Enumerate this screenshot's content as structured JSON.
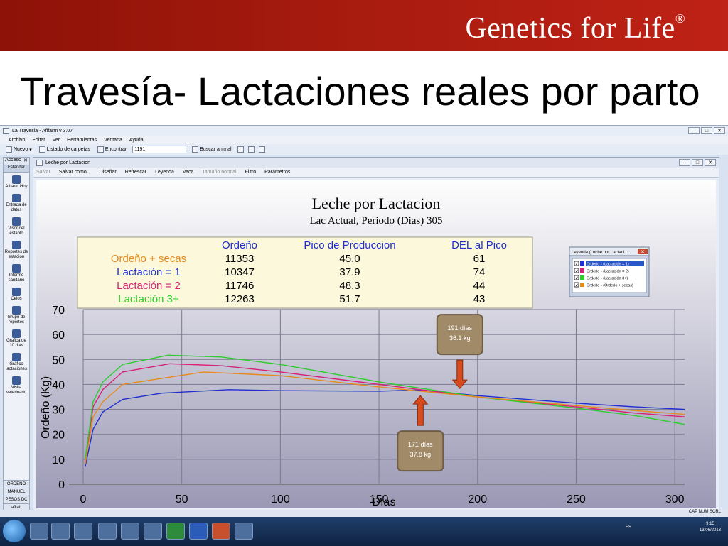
{
  "slide": {
    "brand": "Genetics for Life",
    "brand_mark": "®",
    "title": "Travesía- Lactaciones reales por parto"
  },
  "app": {
    "title": "La Travesia - Afifarm v 3.07",
    "menu": [
      "Archivo",
      "Editar",
      "Ver",
      "Herramientas",
      "Ventana",
      "Ayuda"
    ],
    "toolbar": {
      "nuevo": "Nuevo",
      "listado": "Listado de carpetas",
      "encontrar": "Encontrar",
      "search_value": "1191",
      "buscar": "Buscar animal"
    },
    "sidebar": {
      "header": "Acceso",
      "tab": "Estandar",
      "items": [
        "Afifarm Hoy",
        "Entrada de datos",
        "Visor del establo",
        "Reportes de estacion",
        "Informe sanitario",
        "Celos",
        "Grupo de reportes",
        "Grafica de 10 dias",
        "Gráfico lactaciones",
        "Visita veterinario"
      ],
      "bottom": [
        "ORDEÑO",
        "MANUEL",
        "PESOS DC",
        "afilab"
      ]
    },
    "child": {
      "title": "Leche por Lactacion",
      "toolbar": [
        "Salvar",
        "Salvar como...",
        "Diseñar",
        "Refrescar",
        "Leyenda",
        "Vaca",
        "Tamaño normal",
        "Filtro",
        "Parámetros"
      ]
    },
    "status": "CAP NUM SCRL",
    "tray": {
      "lang": "ES",
      "time": "9:15",
      "date": "13/06/2013"
    }
  },
  "chart_data": {
    "type": "line",
    "title": "Leche por Lactacion",
    "subtitle": "Lac Actual, Periodo (Dias) 305",
    "xlabel": "Días",
    "ylabel": "Ordeño (Kg)",
    "xlim": [
      0,
      305
    ],
    "ylim": [
      0,
      70
    ],
    "xticks": [
      0,
      50,
      100,
      150,
      200,
      250,
      300
    ],
    "yticks": [
      0,
      10,
      20,
      30,
      40,
      50,
      60,
      70
    ],
    "grid": true,
    "table": {
      "headers": [
        "Ordeño",
        "Pico de Produccion",
        "DEL al Pico"
      ],
      "rows": [
        {
          "label": "Ordeño + secas",
          "color": "#e68a1e",
          "ordeno": "11353",
          "pico": "45.0",
          "del": "61"
        },
        {
          "label": "Lactación = 1",
          "color": "#1f2fcf",
          "ordeno": "10347",
          "pico": "37.9",
          "del": "74"
        },
        {
          "label": "Lactación = 2",
          "color": "#d8207a",
          "ordeno": "11746",
          "pico": "48.3",
          "del": "44"
        },
        {
          "label": "Lactación 3+",
          "color": "#2ecc2e",
          "ordeno": "12263",
          "pico": "51.7",
          "del": "43"
        }
      ]
    },
    "legend": {
      "title": "Leyenda (Leche por Lactaci...",
      "items": [
        "Ordeño - (Lactación = 1)",
        "Ordeño - (Lactación = 2)",
        "Ordeño - (Lactación 3+)",
        "Ordeño - (Ordeño + secas)"
      ],
      "colors": [
        "#1f2fcf",
        "#d8207a",
        "#2ecc2e",
        "#e68a1e"
      ]
    },
    "series": [
      {
        "name": "Ordeño - (Lactación = 1)",
        "color": "#1f2fcf",
        "x": [
          1,
          5,
          10,
          20,
          40,
          74,
          100,
          150,
          171,
          200,
          250,
          280,
          305
        ],
        "y": [
          7,
          22,
          29,
          34,
          36.5,
          37.9,
          37.5,
          37.3,
          37.8,
          35.5,
          32.5,
          31,
          30
        ]
      },
      {
        "name": "Ordeño - (Lactación = 2)",
        "color": "#d8207a",
        "x": [
          1,
          5,
          10,
          20,
          44,
          70,
          100,
          150,
          200,
          250,
          280,
          305
        ],
        "y": [
          9,
          31,
          38,
          45,
          48.3,
          47.5,
          45,
          40,
          35,
          31,
          28.5,
          27
        ]
      },
      {
        "name": "Ordeño - (Lactación 3+)",
        "color": "#2ecc2e",
        "x": [
          1,
          5,
          10,
          20,
          43,
          70,
          100,
          150,
          191,
          200,
          250,
          280,
          305
        ],
        "y": [
          10,
          33,
          41,
          48,
          51.7,
          51,
          48,
          41,
          36.1,
          35,
          30.5,
          27.5,
          24
        ]
      },
      {
        "name": "Ordeño - (Ordeño + secas)",
        "color": "#e68a1e",
        "x": [
          1,
          5,
          10,
          20,
          61,
          100,
          150,
          200,
          250,
          280,
          305
        ],
        "y": [
          8,
          27,
          33,
          40,
          45,
          43.5,
          39,
          35,
          31.5,
          29.5,
          28
        ]
      }
    ],
    "annotations": [
      {
        "text1": "191 días",
        "text2": "36.1 kg",
        "x": 191,
        "y": 36.1,
        "arrow": "down"
      },
      {
        "text1": "171 días",
        "text2": "37.8 kg",
        "x": 171,
        "y": 37.8,
        "arrow": "up"
      }
    ]
  }
}
